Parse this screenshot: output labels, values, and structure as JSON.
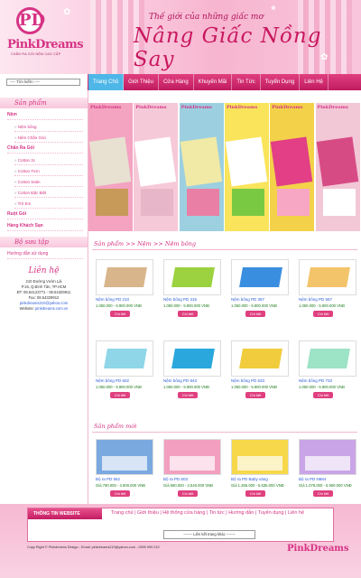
{
  "header": {
    "logo_letter": "PD",
    "logo_text": "PinkDreams",
    "logo_tagline": "CHĂN RA GỐI NỆM CAO CẤP",
    "slogan_small": "Thế giới của những giấc mơ",
    "slogan_big": "Nâng Giấc Nồng Say"
  },
  "nav": {
    "search_placeholder": "---- Tìm kiếm ----",
    "items": [
      "Trang Chủ",
      "Giới Thiệu",
      "Cửa Hàng",
      "Khuyến Mãi",
      "Tin Tức",
      "Tuyển Dụng",
      "Liên Hệ"
    ]
  },
  "sidebar": {
    "products_title": "Sản phẩm",
    "items": [
      {
        "label": "Nệm",
        "type": "cat"
      },
      {
        "label": "Nệm bông",
        "type": "sub"
      },
      {
        "label": "Nệm Chần Gòn",
        "type": "sub"
      },
      {
        "label": "Chăn Ra Gối",
        "type": "cat"
      },
      {
        "label": "Cotton 3c",
        "type": "sub"
      },
      {
        "label": "Cotton Trơn",
        "type": "sub"
      },
      {
        "label": "Cotton Satin",
        "type": "sub"
      },
      {
        "label": "Cotton Đặc Biệt",
        "type": "sub"
      },
      {
        "label": "Trẻ Em",
        "type": "sub"
      },
      {
        "label": "Ruột Gối",
        "type": "cat"
      },
      {
        "label": "Hàng Khách Sạn",
        "type": "cat"
      }
    ],
    "collection_title": "Bộ sưu tập",
    "guide_label": "Hướng dẫn sử dụng",
    "contact": {
      "title": "Liên hệ",
      "lines": [
        "210 Đường Vườn Lài",
        "P.15, Q.Bình Tân, TP.HCM",
        "ĐT: 08.54123771 - 08.54329911",
        "Fax: 08.54329912"
      ],
      "email": "pinkdreams210@yahoo.com",
      "website_label": "Website:",
      "website": "pinkdreams.com.vn"
    }
  },
  "banner": {
    "brand": "PinkDreams",
    "images": [
      {
        "colors": [
          "#f4a3c1",
          "#e8e0d0",
          "#c79a5a"
        ]
      },
      {
        "colors": [
          "#f6c9d8",
          "#ffffff",
          "#e7b6c9"
        ]
      },
      {
        "colors": [
          "#9cd0e0",
          "#f1e9a6",
          "#e97fa4"
        ]
      },
      {
        "colors": [
          "#f9e45b",
          "#ffffff",
          "#7ac943"
        ]
      },
      {
        "colors": [
          "#f3d24a",
          "#e23f86",
          "#f7a7c4"
        ]
      },
      {
        "colors": [
          "#f2c7d6",
          "#d74b85",
          "#ffffff"
        ]
      }
    ]
  },
  "breadcrumb": "Sản phẩm >> Nệm >> Nệm bông",
  "products": [
    {
      "name": "Nệm bông PD 210",
      "price": "1.050.000 - 5.900.000 VNĐ",
      "color": "#d8b58a"
    },
    {
      "name": "Nệm bông PD 315",
      "price": "1.050.000 - 5.900.000 VNĐ",
      "color": "#9cd23f"
    },
    {
      "name": "Nệm bông PD 357",
      "price": "1.050.000 - 5.900.000 VNĐ",
      "color": "#3a8ee0"
    },
    {
      "name": "Nệm bông PD 567",
      "price": "1.050.000 - 5.900.000 VNĐ",
      "color": "#f3c46a"
    },
    {
      "name": "Nệm bông PD 602",
      "price": "1.050.000 - 5.900.000 VNĐ",
      "color": "#8ed6e8"
    },
    {
      "name": "Nệm bông PD 943",
      "price": "1.050.000 - 5.900.000 VNĐ",
      "color": "#2aa8dd"
    },
    {
      "name": "Nệm bông PD 633",
      "price": "1.050.000 - 5.900.000 VNĐ",
      "color": "#f1cc3d"
    },
    {
      "name": "Nệm bông PD 733",
      "price": "1.050.000 - 5.900.000 VNĐ",
      "color": "#9de3c6"
    }
  ],
  "buy_label": "Chi tiết",
  "new_products_title": "Sản phẩm mới",
  "new_products": [
    {
      "name": "Bộ ra PD 562",
      "price": "Giá 790.000 - 3.900.000 VNĐ",
      "color": "#7aa9e0"
    },
    {
      "name": "Bộ ra PD 603",
      "price": "Giá 690.000 - 2.540.000 VNĐ",
      "color": "#f29fc0"
    },
    {
      "name": "Bộ ra PD Baby vàng",
      "price": "Giá 1.365.000 - 5.635.000 VNĐ",
      "color": "#f6d84a"
    },
    {
      "name": "Bộ ra PD N684",
      "price": "Giá 1.078.000 - 5.900.000 VNĐ",
      "color": "#c9a4e6"
    }
  ],
  "footer": {
    "tab_label": "THÔNG TIN WEBSITE",
    "links": "Trang chủ | Giới thiệu | Hệ thống cửa hàng | Tin tức | Hướng dẫn | Tuyển dụng | Liên hệ",
    "select_label": "------- Liên kết trang khác -------",
    "copyright": "Copy Right © Pinkdreams Design - Email: pinkdreams210@yahoo.com - 0909 099 210",
    "logo_text": "PinkDreams"
  }
}
